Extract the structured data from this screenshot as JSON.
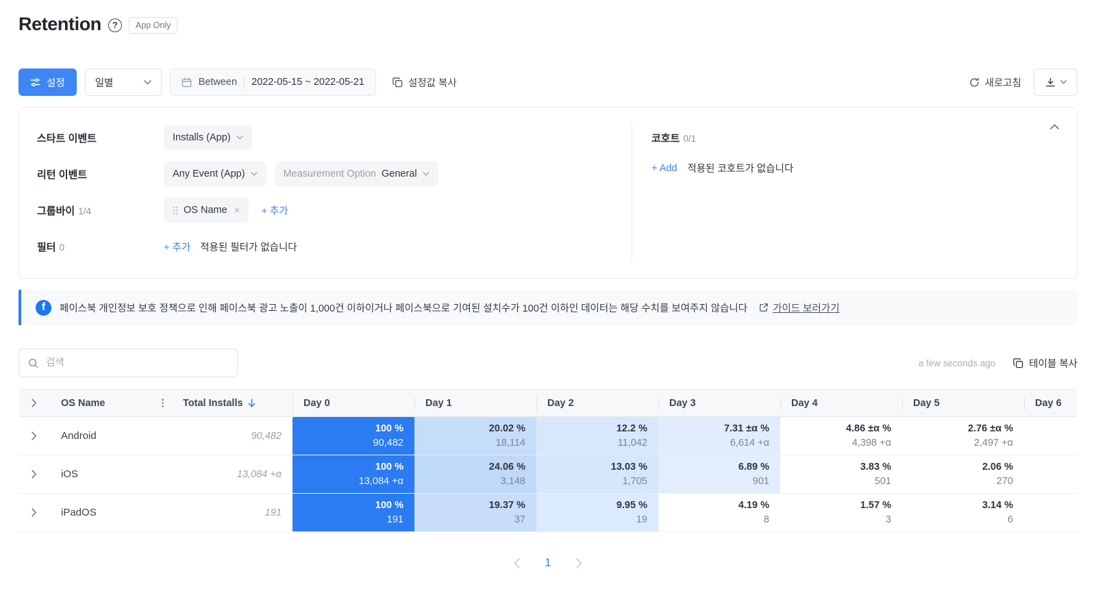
{
  "page": {
    "title": "Retention",
    "badge": "App Only"
  },
  "toolbar": {
    "settings": "설정",
    "granularity": "일별",
    "date_mode": "Between",
    "date_range": "2022-05-15 ~ 2022-05-21",
    "copy_settings": "설정값 복사",
    "refresh": "새로고침"
  },
  "config": {
    "start_event": {
      "label": "스타트 이벤트",
      "value": "Installs (App)"
    },
    "return_event": {
      "label": "리턴 이벤트",
      "value": "Any Event (App)",
      "measurement_label": "Measurement Option",
      "measurement_value": "General"
    },
    "group_by": {
      "label": "그룹바이",
      "count": "1/4",
      "chip": "OS Name",
      "add": "+ 추가"
    },
    "filter": {
      "label": "필터",
      "count": "0",
      "add": "+ 추가",
      "empty": "적용된 필터가 없습니다"
    },
    "cohort": {
      "label": "코호트",
      "count": "0/1",
      "add": "+ Add",
      "empty": "적용된 코호트가 없습니다"
    }
  },
  "notice": {
    "text": "페이스북 개인정보 보호 정책으로 인해 페이스북 광고 노출이 1,000건 이하이거나 페이스북으로 기여된 설치수가 100건 이하인 데이터는 해당 수치를 보여주지 않습니다",
    "link": "가이드 보러가기"
  },
  "table_toolbar": {
    "search_placeholder": "검색",
    "updated": "a few seconds ago",
    "copy_table": "테이블 복사"
  },
  "table": {
    "os_header": "OS Name",
    "total_header": "Total Installs",
    "day_headers": [
      "Day 0",
      "Day 1",
      "Day 2",
      "Day 3",
      "Day 4",
      "Day 5",
      "Day 6"
    ],
    "rows": [
      {
        "os": "Android",
        "total": "90,482",
        "cells": [
          {
            "pct": "100 %",
            "count": "90,482",
            "bg": "#2b7bf2"
          },
          {
            "pct": "20.02 %",
            "count": "18,114",
            "bg": "#c6ddfa"
          },
          {
            "pct": "12.2 %",
            "count": "11,042",
            "bg": "#d7e7fc"
          },
          {
            "pct": "7.31 ±α %",
            "count": "6,614 +α",
            "bg": "#e1edfd"
          },
          {
            "pct": "4.86 ±α %",
            "count": "4,398 +α",
            "bg": "#ffffff"
          },
          {
            "pct": "2.76 ±α %",
            "count": "2,497 +α",
            "bg": "#ffffff"
          },
          {
            "pct": "",
            "count": "",
            "bg": "#ffffff"
          }
        ]
      },
      {
        "os": "iOS",
        "total": "13,084 +α",
        "cells": [
          {
            "pct": "100 %",
            "count": "13,084 +α",
            "bg": "#2b7bf2"
          },
          {
            "pct": "24.06 %",
            "count": "3,148",
            "bg": "#bfd9f9"
          },
          {
            "pct": "13.03 %",
            "count": "1,705",
            "bg": "#d5e6fb"
          },
          {
            "pct": "6.89 %",
            "count": "901",
            "bg": "#e2eefd"
          },
          {
            "pct": "3.83 %",
            "count": "501",
            "bg": "#ffffff"
          },
          {
            "pct": "2.06 %",
            "count": "270",
            "bg": "#ffffff"
          },
          {
            "pct": "",
            "count": "",
            "bg": "#ffffff"
          }
        ]
      },
      {
        "os": "iPadOS",
        "total": "191",
        "cells": [
          {
            "pct": "100 %",
            "count": "191",
            "bg": "#2b7bf2"
          },
          {
            "pct": "19.37 %",
            "count": "37",
            "bg": "#c7ddfa"
          },
          {
            "pct": "9.95 %",
            "count": "19",
            "bg": "#dbeafc"
          },
          {
            "pct": "4.19 %",
            "count": "8",
            "bg": "#ffffff"
          },
          {
            "pct": "1.57 %",
            "count": "3",
            "bg": "#ffffff"
          },
          {
            "pct": "3.14 %",
            "count": "6",
            "bg": "#ffffff"
          },
          {
            "pct": "",
            "count": "",
            "bg": "#ffffff"
          }
        ]
      }
    ]
  },
  "pagination": {
    "page": "1"
  },
  "colors": {
    "accent": "#3b82f6",
    "day0": "#2b7bf2",
    "facebook": "#1877f2",
    "settings_button": "#3d86f5"
  }
}
